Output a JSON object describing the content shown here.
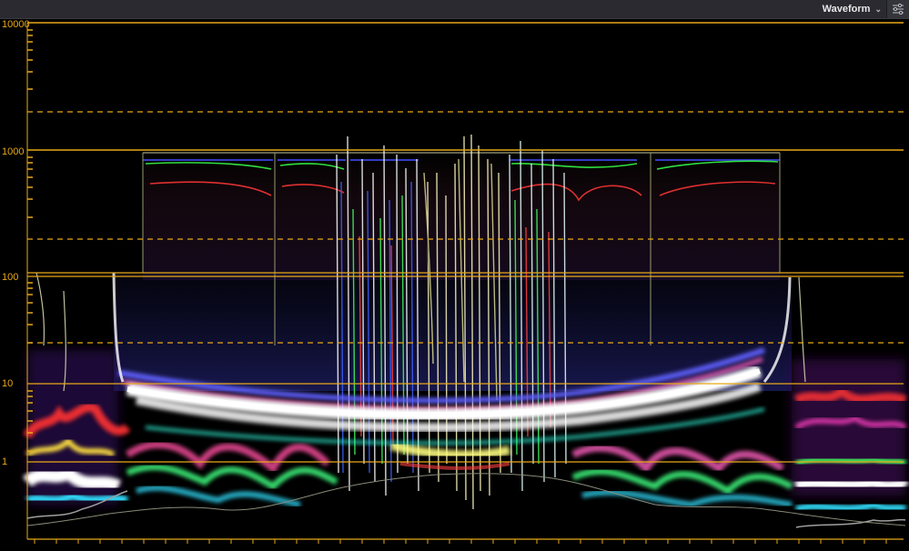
{
  "toolbar": {
    "scope_type": "Waveform",
    "chevron_icon": "chevron-down-icon",
    "settings_icon": "sliders-icon"
  },
  "scale": {
    "labels": [
      "10000",
      "1000",
      "100",
      "10",
      "1"
    ],
    "units_note": ""
  },
  "colors": {
    "graticule": "#e8a818",
    "background": "#000000",
    "toolbar_bg": "#2a2a30"
  }
}
